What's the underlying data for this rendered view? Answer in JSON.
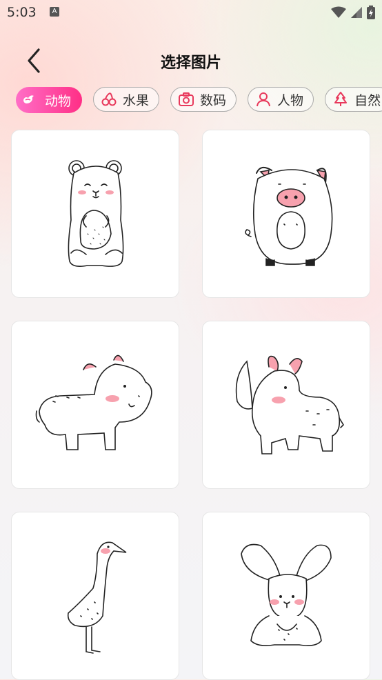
{
  "status": {
    "time": "5:03",
    "notification_letter": "A"
  },
  "header": {
    "title": "选择图片"
  },
  "tabs": [
    {
      "label": "动物",
      "icon": "bird-icon",
      "active": true
    },
    {
      "label": "水果",
      "icon": "cherry-icon",
      "active": false
    },
    {
      "label": "数码",
      "icon": "camera-icon",
      "active": false
    },
    {
      "label": "人物",
      "icon": "person-icon",
      "active": false
    },
    {
      "label": "自然",
      "icon": "tree-icon",
      "active": false
    }
  ],
  "images": [
    {
      "name": "bear"
    },
    {
      "name": "pig"
    },
    {
      "name": "hippo"
    },
    {
      "name": "rhino"
    },
    {
      "name": "crane"
    },
    {
      "name": "rabbit"
    }
  ],
  "colors": {
    "accent_start": "#ff6ec7",
    "accent_end": "#ff2f86",
    "blush": "#f7a1ae"
  }
}
